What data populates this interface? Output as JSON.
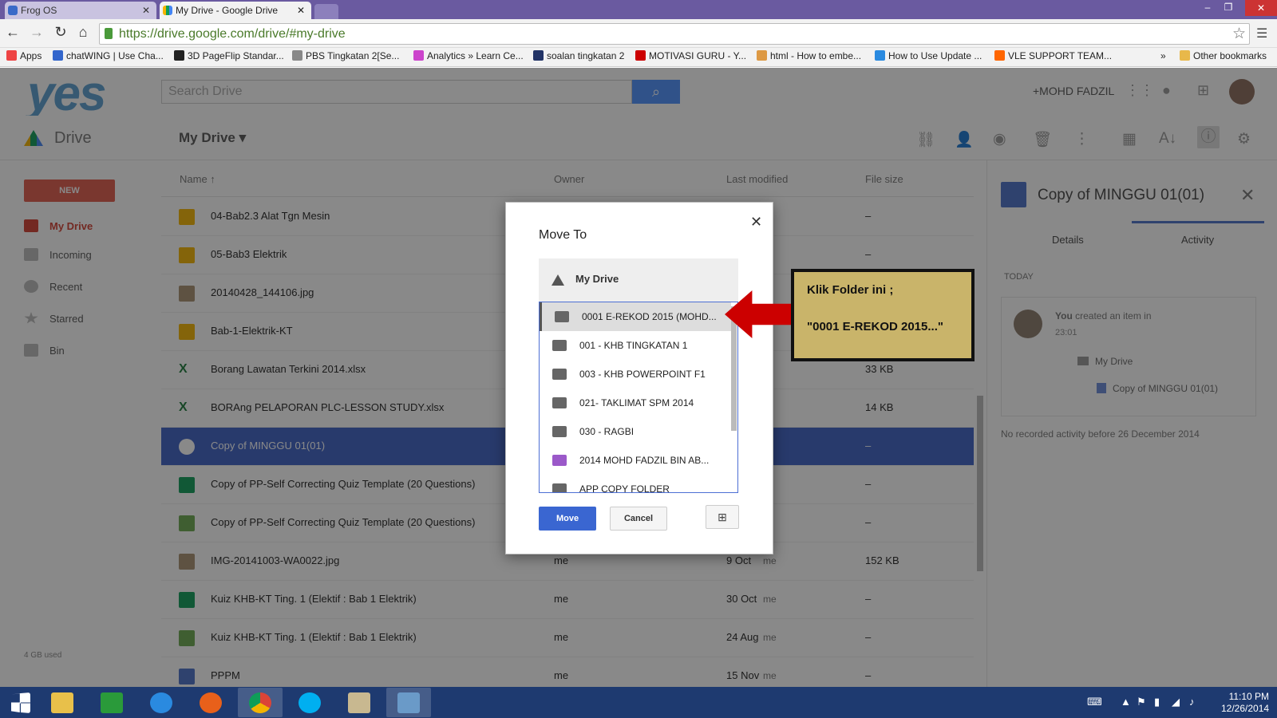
{
  "browser": {
    "tabs": [
      {
        "label": "Frog OS",
        "active": false
      },
      {
        "label": "My Drive - Google Drive",
        "active": true
      }
    ],
    "url": "https://drive.google.com/drive/#my-drive",
    "bookmarks": [
      "Apps",
      "chatWING | Use Cha...",
      "3D PageFlip Standar...",
      "PBS Tingkatan 2[Se...",
      "Analytics » Learn Ce...",
      "soalan tingkatan 2",
      "MOTIVASI GURU - Y...",
      "html - How to embe...",
      "How to Use Update ...",
      "VLE SUPPORT TEAM...",
      "»",
      "Other bookmarks"
    ]
  },
  "header": {
    "logo": "yes",
    "search_placeholder": "Search Drive",
    "user": "+MOHD FADZIL"
  },
  "subheader": {
    "app_name": "Drive",
    "location": "My Drive ▾"
  },
  "sidebar": {
    "new_label": "NEW",
    "items": [
      {
        "label": "My Drive",
        "active": true
      },
      {
        "label": "Incoming",
        "active": false
      },
      {
        "label": "Recent",
        "active": false
      },
      {
        "label": "Starred",
        "active": false
      },
      {
        "label": "Bin",
        "active": false
      }
    ],
    "quota": "4 GB used"
  },
  "list": {
    "columns": [
      "Name ↑",
      "Owner",
      "Last modified",
      "File size"
    ],
    "rows": [
      {
        "name": "04-Bab2.3 Alat Tgn Mesin",
        "owner": "",
        "modified": "",
        "modified_by": "",
        "size": "–",
        "icon": "slides-icon",
        "selected": false
      },
      {
        "name": "05-Bab3 Elektrik",
        "owner": "",
        "modified": "",
        "modified_by": "",
        "size": "–",
        "icon": "slides-icon",
        "selected": false
      },
      {
        "name": "20140428_144106.jpg",
        "owner": "",
        "modified": "",
        "modified_by": "",
        "size": "",
        "icon": "image-icon",
        "selected": false
      },
      {
        "name": "Bab-1-Elektrik-KT",
        "owner": "",
        "modified": "",
        "modified_by": "",
        "size": "",
        "icon": "slides-icon",
        "selected": false
      },
      {
        "name": "Borang Lawatan Terkini 2014.xlsx",
        "owner": "",
        "modified": "",
        "modified_by": "",
        "size": "33 KB",
        "icon": "excel-icon",
        "selected": false
      },
      {
        "name": "BORAng PELAPORAN PLC-LESSON STUDY.xlsx",
        "owner": "",
        "modified": "",
        "modified_by": "",
        "size": "14 KB",
        "icon": "excel-icon",
        "selected": false
      },
      {
        "name": "Copy of MINGGU 01(01)",
        "owner": "",
        "modified": "",
        "modified_by": "",
        "size": "–",
        "icon": "doc-icon",
        "selected": true
      },
      {
        "name": "Copy of PP-Self Correcting Quiz Template (20 Questions)",
        "owner": "",
        "modified": "",
        "modified_by": "",
        "size": "–",
        "icon": "sheet-icon",
        "selected": false
      },
      {
        "name": "Copy of PP-Self Correcting Quiz Template (20 Questions)",
        "owner": "",
        "modified": "",
        "modified_by": "",
        "size": "–",
        "icon": "form-icon",
        "selected": false
      },
      {
        "name": "IMG-20141003-WA0022.jpg",
        "owner": "me",
        "modified": "9 Oct",
        "modified_by": "me",
        "size": "152 KB",
        "icon": "image-icon",
        "selected": false
      },
      {
        "name": "Kuiz KHB-KT Ting. 1 (Elektif : Bab 1 Elektrik)",
        "owner": "me",
        "modified": "30 Oct",
        "modified_by": "me",
        "size": "–",
        "icon": "sheet-icon",
        "selected": false
      },
      {
        "name": "Kuiz KHB-KT Ting. 1 (Elektif : Bab 1 Elektrik)",
        "owner": "me",
        "modified": "24 Aug",
        "modified_by": "me",
        "size": "–",
        "icon": "form-icon",
        "selected": false
      },
      {
        "name": "PPPM",
        "owner": "me",
        "modified": "15 Nov",
        "modified_by": "me",
        "size": "–",
        "icon": "doc-icon",
        "selected": false
      }
    ]
  },
  "details_panel": {
    "title": "Copy of MINGGU 01(01)",
    "tabs": [
      "Details",
      "Activity"
    ],
    "active_tab": "Activity",
    "today": "TODAY",
    "activity_user": "You",
    "activity_text": " created an item in",
    "activity_time": "23:01",
    "activity_folder": "My Drive",
    "activity_file": "Copy of MINGGU 01(01)",
    "no_activity": "No recorded activity before 26 December 2014"
  },
  "dialog": {
    "title": "Move To",
    "root": "My Drive",
    "folders": [
      {
        "label": "0001 E-REKOD 2015 (MOHD...",
        "highlighted": true,
        "color": "#666666"
      },
      {
        "label": "001 - KHB TINGKATAN 1",
        "highlighted": false,
        "color": "#666666"
      },
      {
        "label": "003 - KHB POWERPOINT F1",
        "highlighted": false,
        "color": "#666666"
      },
      {
        "label": "021- TAKLIMAT SPM 2014",
        "highlighted": false,
        "color": "#666666"
      },
      {
        "label": "030 - RAGBI",
        "highlighted": false,
        "color": "#666666"
      },
      {
        "label": "2014 MOHD FADZIL BIN AB...",
        "highlighted": false,
        "color": "#9b59c9"
      },
      {
        "label": "APP COPY FOLDER",
        "highlighted": false,
        "color": "#666666"
      }
    ],
    "move_label": "Move",
    "cancel_label": "Cancel"
  },
  "callout": {
    "line1": "Klik Folder ini ;",
    "line2": "\"0001 E-REKOD 2015...\""
  },
  "taskbar": {
    "time": "11:10 PM",
    "date": "12/26/2014"
  }
}
